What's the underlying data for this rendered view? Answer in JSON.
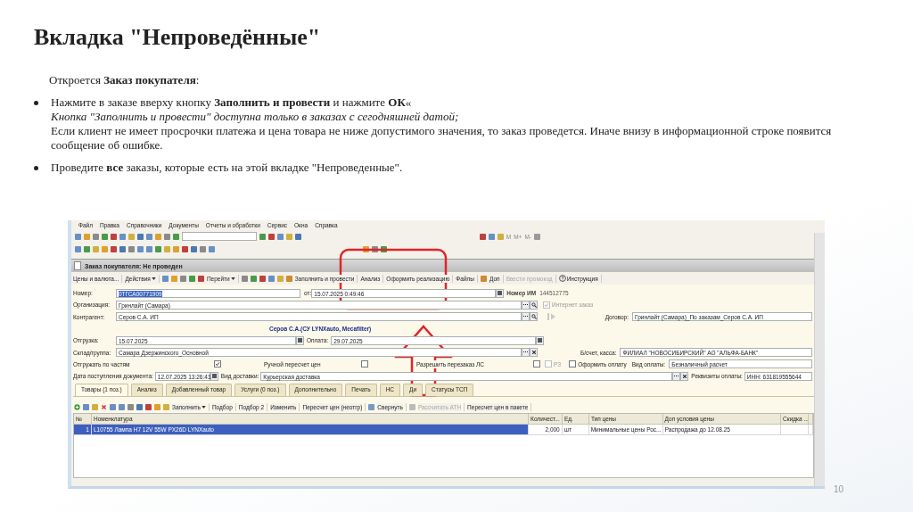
{
  "slide": {
    "title": "Вкладка \"Непроведённые\"",
    "intro": "Откроется **Заказ покупателя**:",
    "bullets": [
      {
        "paragraphs": [
          {
            "text": "Нажмите в заказе вверху кнопку **Заполнить и провести** и нажмите **ОК**«",
            "italic": false
          },
          {
            "text": "Кнопка \"Заполнить и провести\" доступна только в заказах с сегодняшней датой;",
            "italic": true
          },
          {
            "text": "Если клиент не имеет просрочки платежа и цена товара не ниже допустимого значения, то заказ проведется. Иначе внизу в информационной строке появится сообщение об ошибке.",
            "italic": false
          }
        ]
      },
      {
        "paragraphs": [
          {
            "text": "Проведите **все** заказы, которые есть на этой вкладке \"Непроведенные\".",
            "italic": false
          }
        ]
      }
    ],
    "page_number": "10"
  },
  "app": {
    "menu": [
      "Файл",
      "Правка",
      "Справочники",
      "Документы",
      "Отчеты и обработки",
      "Сервис",
      "Окна",
      "Справка"
    ],
    "memory_keys": [
      "M",
      "M+",
      "M-"
    ],
    "document_title": "Заказ покупателя: Не проведен",
    "commands": [
      {
        "label": "Цены и валюта...",
        "kind": "plain"
      },
      {
        "label": "Действия",
        "kind": "dropdown"
      },
      {
        "label": "Перейти",
        "kind": "dropdown"
      },
      {
        "label": "Заполнить и провести",
        "kind": "icon"
      },
      {
        "label": "Анализ",
        "kind": "plain"
      },
      {
        "label": "Оформить реализацию",
        "kind": "plain"
      },
      {
        "label": "Файлы",
        "kind": "plain"
      },
      {
        "label": "Доп",
        "kind": "icon"
      },
      {
        "label": "Ввести промокод",
        "kind": "disabled"
      },
      {
        "label": "Инструкция",
        "kind": "help"
      }
    ],
    "form": {
      "number": {
        "label": "Номер:",
        "value": "0ТГСА00771909",
        "highlighted": true
      },
      "date": {
        "label": "от:",
        "value": "15.07.2025 0:49:46"
      },
      "im_number": {
        "label": "Номер ИМ",
        "value": "144512775"
      },
      "organization": {
        "label": "Организация:",
        "value": "Гринлайт (Самара)"
      },
      "internet_order": {
        "label": "Интернет заказ",
        "checked": true,
        "disabled": true
      },
      "counterparty": {
        "label": "Контрагент:",
        "value": "Серов С.А. ИП"
      },
      "contract": {
        "label": "Договор:",
        "value": "Гринлайт (Самара)_По заказам_Серов С.А. ИП"
      },
      "counterparty_note": "Серов С.А.(СУ LYNXauto, Mecafilter)",
      "shipment": {
        "label": "Отгрузка:",
        "value": "15.07.2025"
      },
      "payment": {
        "label": "Оплата:",
        "value": "29.07.2025"
      },
      "warehouse": {
        "label": "Склад/группа:",
        "value": "Самара Дзержинского_Основной"
      },
      "bank_account": {
        "label": "Б/счет, касса:",
        "value": "ФИЛИАЛ \"НОВОСИБИРСКИЙ\" АО \"АЛЬФА-БАНК\""
      },
      "options": [
        {
          "label": "Отгружать по частям",
          "checked": true,
          "disabled": false,
          "kind": "label_first"
        },
        {
          "label": "Ручной пересчет цен",
          "checked": false,
          "disabled": false,
          "kind": "label_first"
        },
        {
          "label": "Разрешить перезаказ ЛС",
          "checked": false,
          "disabled": false,
          "kind": "label_first"
        },
        {
          "label": "РЗ",
          "checked": false,
          "disabled": true,
          "kind": "box_first"
        },
        {
          "label": "Оформить оплату",
          "checked": false,
          "disabled": false,
          "kind": "box_first"
        }
      ],
      "payment_type": {
        "label": "Вид оплаты:",
        "value": "Безналичный расчет"
      },
      "receipt_date": {
        "label": "Дата поступления документа:",
        "value": "12.07.2025 13:26:41"
      },
      "delivery": {
        "label": "Вид доставки:",
        "value": "Курьерская доставка"
      },
      "payment_details": {
        "label": "Реквизиты оплаты:",
        "value": "ИНН: 631819555644"
      }
    },
    "tabs": [
      {
        "label": "Товары (1 поз.)",
        "selected": true
      },
      {
        "label": "Анализ",
        "selected": false
      },
      {
        "label": "Добавленный товар",
        "selected": false
      },
      {
        "label": "Услуги (0 поз.)",
        "selected": false
      },
      {
        "label": "Дополнительно",
        "selected": false
      },
      {
        "label": "Печать",
        "selected": false
      },
      {
        "label": "НС",
        "selected": false
      },
      {
        "label": "Ди",
        "selected": false
      },
      {
        "label": "Статусы ТСП",
        "selected": false
      }
    ],
    "table_commands": [
      {
        "label": "Заполнить",
        "kind": "dropdown"
      },
      {
        "label": "Подбор",
        "kind": "plain"
      },
      {
        "label": "Подбор 2",
        "kind": "plain"
      },
      {
        "label": "Изменить",
        "kind": "plain"
      },
      {
        "label": "Пересчет цен (неотгр)",
        "kind": "plain"
      },
      {
        "label": "Свернуть",
        "kind": "icon"
      },
      {
        "label": "Рассчитать АТН",
        "kind": "disabled"
      },
      {
        "label": "Пересчет цен в пакете",
        "kind": "plain"
      }
    ],
    "table": {
      "columns": [
        "№",
        "Номенклатура",
        "Количест...",
        "Ед.",
        "Тип цены",
        "Доп условия цены",
        "Скидка ..."
      ],
      "rows": [
        {
          "cells": [
            "1",
            "L10755 Лампа H7 12V 55W PX26D LYNXauto",
            "2,000",
            "шт",
            "Минимальные цены Рос...",
            "Распродажа до 12.08.25",
            ""
          ],
          "selected": true
        }
      ]
    }
  }
}
